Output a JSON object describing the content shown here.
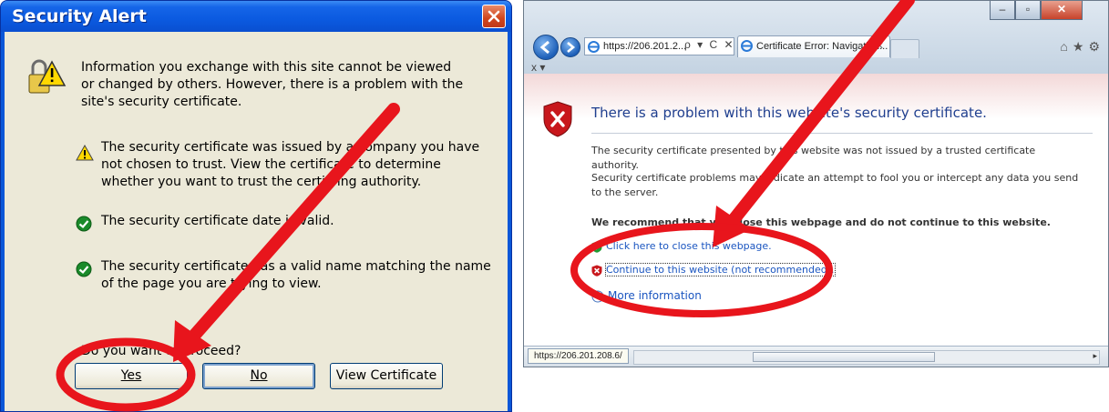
{
  "security_alert": {
    "title": "Security Alert",
    "intro": "Information you exchange with this site cannot be viewed or changed by others. However, there is a problem with the site's security certificate.",
    "items": [
      {
        "icon": "warning-icon",
        "text": "The security certificate was issued by a company you have not chosen to trust. View the certificate to determine whether you want to trust the certifying authority."
      },
      {
        "icon": "check-icon",
        "text": "The security certificate date is valid."
      },
      {
        "icon": "check-icon",
        "text": "The security certificate has a valid name matching the name of the page you are trying to view."
      }
    ],
    "question": "Do you want to proceed?",
    "buttons": {
      "yes": "Yes",
      "no": "No",
      "view_certificate": "View Certificate"
    }
  },
  "ie_window": {
    "address": "https://206.201.2...",
    "address_tools": "ρ ▾ C ✕",
    "tab_title": "Certificate Error: Navigation...",
    "command_bar": "x  ▾",
    "heading": "There is a problem with this website's security certificate.",
    "para1": "The security certificate presented by this website was not issued by a trusted certificate authority.",
    "para2": "Security certificate problems may indicate an attempt to fool you or intercept any data you send to the server.",
    "recommendation": "We recommend that you close this webpage and do not continue to this website.",
    "close_link": "Click here to close this webpage.",
    "continue_link": "Continue to this website (not recommended).",
    "more_info": "More information",
    "status_url": "https://206.201.208.6/"
  },
  "colors": {
    "annotation_red": "#e8151c",
    "xp_title_blue": "#0b5ae0",
    "xp_face": "#ece9d8",
    "ie_link": "#1a55c0"
  }
}
